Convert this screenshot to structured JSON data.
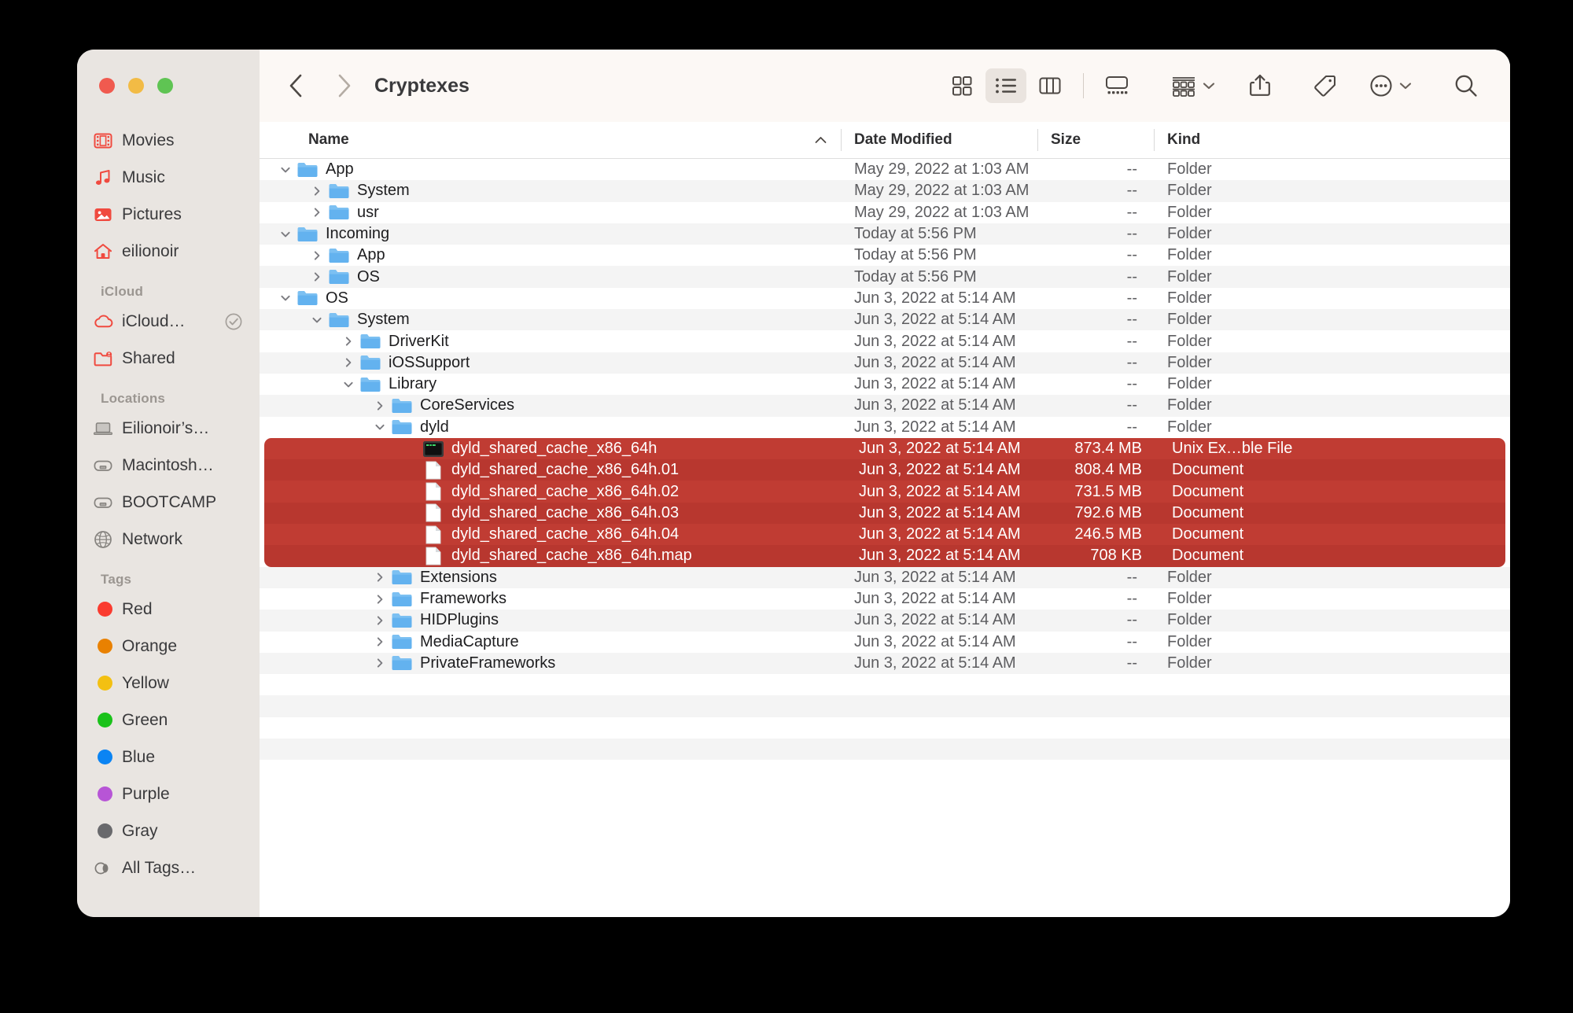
{
  "window": {
    "title": "Cryptexes",
    "traffic_lights": [
      "close-red",
      "minimize-yellow",
      "maximize-green"
    ]
  },
  "toolbar": {
    "back_icon": "chevron-left-icon",
    "forward_icon": "chevron-right-icon",
    "view_icon_grid": "icon-view-icon",
    "view_icon_list": "list-view-icon",
    "view_icon_column": "column-view-icon",
    "view_icon_gallery": "gallery-view-icon",
    "group_icon": "group-by-icon",
    "share_icon": "share-icon",
    "tag_icon": "tag-icon",
    "more_icon": "more-actions-icon",
    "search_icon": "search-icon",
    "active_view": "list"
  },
  "sidebar": {
    "favorites": [
      {
        "label": "Movies",
        "icon": "movies-icon"
      },
      {
        "label": "Music",
        "icon": "music-icon"
      },
      {
        "label": "Pictures",
        "icon": "pictures-icon"
      },
      {
        "label": "eilionoir",
        "icon": "home-icon"
      }
    ],
    "icloud_header": "iCloud",
    "icloud": [
      {
        "label": "iCloud…",
        "icon": "icloud-icon",
        "badge": "download-check-icon"
      },
      {
        "label": "Shared",
        "icon": "shared-folder-icon"
      }
    ],
    "locations_header": "Locations",
    "locations": [
      {
        "label": "Eilionoir’s…",
        "icon": "laptop-icon"
      },
      {
        "label": "Macintosh…",
        "icon": "disk-icon"
      },
      {
        "label": "BOOTCAMP",
        "icon": "disk-icon"
      },
      {
        "label": "Network",
        "icon": "globe-icon"
      }
    ],
    "tags_header": "Tags",
    "tags": [
      {
        "label": "Red",
        "color": "#fa3b2f"
      },
      {
        "label": "Orange",
        "color": "#e98101"
      },
      {
        "label": "Yellow",
        "color": "#f3c012"
      },
      {
        "label": "Green",
        "color": "#1ac21a"
      },
      {
        "label": "Blue",
        "color": "#0b84f3"
      },
      {
        "label": "Purple",
        "color": "#b755d6"
      },
      {
        "label": "Gray",
        "color": "#69696c"
      }
    ],
    "all_tags": {
      "label": "All Tags…",
      "icon": "all-tags-icon"
    }
  },
  "columns": {
    "name": "Name",
    "date_modified": "Date Modified",
    "size": "Size",
    "kind": "Kind",
    "sort_indicator": "chevron-up-icon"
  },
  "colors": {
    "selection_red": "#b8372f",
    "selection_red_alt": "#c03c33",
    "sidebar_bg": "#e9e5e1",
    "toolbar_bg": "#fcf8f5",
    "folder_blue": "#62b4f0"
  },
  "rows": [
    {
      "name": "App",
      "indent": 0,
      "twisty": "down",
      "icon": "folder-icon",
      "date": "May 29, 2022 at 1:03 AM",
      "size": "--",
      "kind": "Folder",
      "alt": false,
      "selected": false
    },
    {
      "name": "System",
      "indent": 1,
      "twisty": "right",
      "icon": "folder-icon",
      "date": "May 29, 2022 at 1:03 AM",
      "size": "--",
      "kind": "Folder",
      "alt": true,
      "selected": false
    },
    {
      "name": "usr",
      "indent": 1,
      "twisty": "right",
      "icon": "folder-icon",
      "date": "May 29, 2022 at 1:03 AM",
      "size": "--",
      "kind": "Folder",
      "alt": false,
      "selected": false
    },
    {
      "name": "Incoming",
      "indent": 0,
      "twisty": "down",
      "icon": "folder-icon",
      "date": "Today at 5:56 PM",
      "size": "--",
      "kind": "Folder",
      "alt": true,
      "selected": false
    },
    {
      "name": "App",
      "indent": 1,
      "twisty": "right",
      "icon": "folder-icon",
      "date": "Today at 5:56 PM",
      "size": "--",
      "kind": "Folder",
      "alt": false,
      "selected": false
    },
    {
      "name": "OS",
      "indent": 1,
      "twisty": "right",
      "icon": "folder-icon",
      "date": "Today at 5:56 PM",
      "size": "--",
      "kind": "Folder",
      "alt": true,
      "selected": false
    },
    {
      "name": "OS",
      "indent": 0,
      "twisty": "down",
      "icon": "folder-icon",
      "date": "Jun 3, 2022 at 5:14 AM",
      "size": "--",
      "kind": "Folder",
      "alt": false,
      "selected": false
    },
    {
      "name": "System",
      "indent": 1,
      "twisty": "down",
      "icon": "folder-icon",
      "date": "Jun 3, 2022 at 5:14 AM",
      "size": "--",
      "kind": "Folder",
      "alt": true,
      "selected": false
    },
    {
      "name": "DriverKit",
      "indent": 2,
      "twisty": "right",
      "icon": "folder-icon",
      "date": "Jun 3, 2022 at 5:14 AM",
      "size": "--",
      "kind": "Folder",
      "alt": false,
      "selected": false
    },
    {
      "name": "iOSSupport",
      "indent": 2,
      "twisty": "right",
      "icon": "folder-icon",
      "date": "Jun 3, 2022 at 5:14 AM",
      "size": "--",
      "kind": "Folder",
      "alt": true,
      "selected": false
    },
    {
      "name": "Library",
      "indent": 2,
      "twisty": "down",
      "icon": "folder-icon",
      "date": "Jun 3, 2022 at 5:14 AM",
      "size": "--",
      "kind": "Folder",
      "alt": false,
      "selected": false
    },
    {
      "name": "CoreServices",
      "indent": 3,
      "twisty": "right",
      "icon": "folder-icon",
      "date": "Jun 3, 2022 at 5:14 AM",
      "size": "--",
      "kind": "Folder",
      "alt": true,
      "selected": false
    },
    {
      "name": "dyld",
      "indent": 3,
      "twisty": "down",
      "icon": "folder-icon",
      "date": "Jun 3, 2022 at 5:14 AM",
      "size": "--",
      "kind": "Folder",
      "alt": false,
      "selected": false
    },
    {
      "name": "dyld_shared_cache_x86_64h",
      "indent": 4,
      "twisty": "none",
      "icon": "executable-icon",
      "date": "Jun 3, 2022 at 5:14 AM",
      "size": "873.4 MB",
      "kind": "Unix Ex…ble File",
      "alt": true,
      "selected": true
    },
    {
      "name": "dyld_shared_cache_x86_64h.01",
      "indent": 4,
      "twisty": "none",
      "icon": "document-icon",
      "date": "Jun 3, 2022 at 5:14 AM",
      "size": "808.4 MB",
      "kind": "Document",
      "alt": false,
      "selected": true
    },
    {
      "name": "dyld_shared_cache_x86_64h.02",
      "indent": 4,
      "twisty": "none",
      "icon": "document-icon",
      "date": "Jun 3, 2022 at 5:14 AM",
      "size": "731.5 MB",
      "kind": "Document",
      "alt": true,
      "selected": true
    },
    {
      "name": "dyld_shared_cache_x86_64h.03",
      "indent": 4,
      "twisty": "none",
      "icon": "document-icon",
      "date": "Jun 3, 2022 at 5:14 AM",
      "size": "792.6 MB",
      "kind": "Document",
      "alt": false,
      "selected": true
    },
    {
      "name": "dyld_shared_cache_x86_64h.04",
      "indent": 4,
      "twisty": "none",
      "icon": "document-icon",
      "date": "Jun 3, 2022 at 5:14 AM",
      "size": "246.5 MB",
      "kind": "Document",
      "alt": true,
      "selected": true
    },
    {
      "name": "dyld_shared_cache_x86_64h.map",
      "indent": 4,
      "twisty": "none",
      "icon": "document-icon",
      "date": "Jun 3, 2022 at 5:14 AM",
      "size": "708 KB",
      "kind": "Document",
      "alt": false,
      "selected": true
    },
    {
      "name": "Extensions",
      "indent": 3,
      "twisty": "right",
      "icon": "folder-icon",
      "date": "Jun 3, 2022 at 5:14 AM",
      "size": "--",
      "kind": "Folder",
      "alt": true,
      "selected": false
    },
    {
      "name": "Frameworks",
      "indent": 3,
      "twisty": "right",
      "icon": "folder-icon",
      "date": "Jun 3, 2022 at 5:14 AM",
      "size": "--",
      "kind": "Folder",
      "alt": false,
      "selected": false
    },
    {
      "name": "HIDPlugins",
      "indent": 3,
      "twisty": "right",
      "icon": "folder-icon",
      "date": "Jun 3, 2022 at 5:14 AM",
      "size": "--",
      "kind": "Folder",
      "alt": true,
      "selected": false
    },
    {
      "name": "MediaCapture",
      "indent": 3,
      "twisty": "right",
      "icon": "folder-icon",
      "date": "Jun 3, 2022 at 5:14 AM",
      "size": "--",
      "kind": "Folder",
      "alt": false,
      "selected": false
    },
    {
      "name": "PrivateFrameworks",
      "indent": 3,
      "twisty": "right",
      "icon": "folder-icon",
      "date": "Jun 3, 2022 at 5:14 AM",
      "size": "--",
      "kind": "Folder",
      "alt": true,
      "selected": false
    }
  ],
  "empty_rows": [
    {
      "alt": false
    },
    {
      "alt": true
    },
    {
      "alt": false
    },
    {
      "alt": true
    }
  ]
}
